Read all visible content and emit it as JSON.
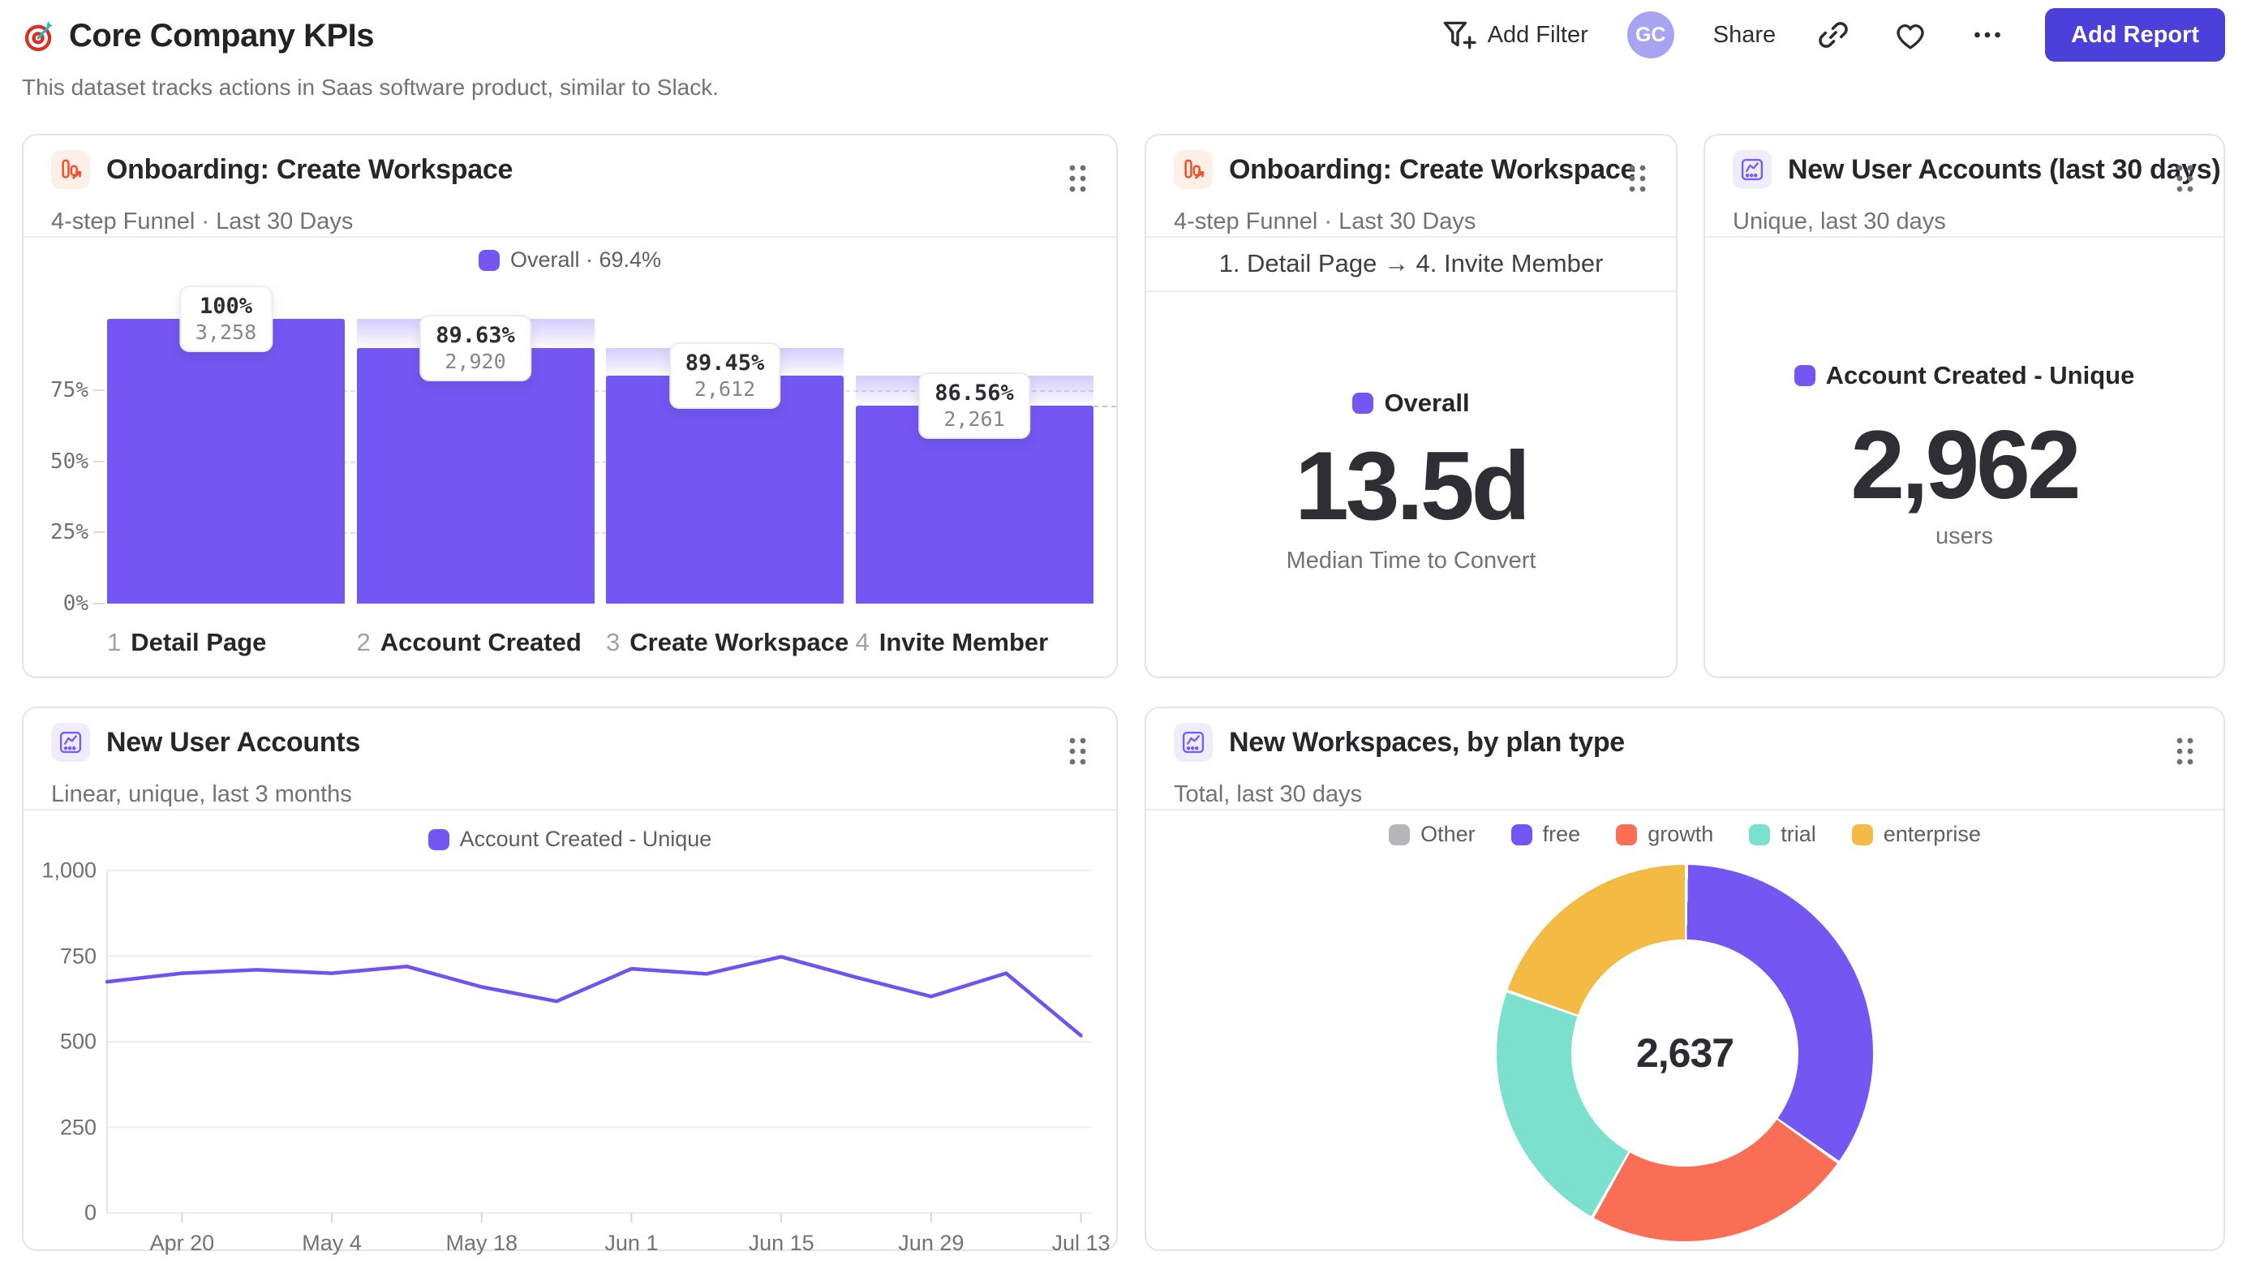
{
  "header": {
    "title": "Core Company KPIs",
    "subtitle": "This dataset tracks actions in Saas software product, similar to Slack.",
    "toolbar": {
      "add_filter_label": "Add Filter",
      "avatar_initials": "GC",
      "share_label": "Share",
      "add_report_label": "Add Report"
    }
  },
  "colors": {
    "accent_purple": "#7456f2",
    "coral": "#fb6e56",
    "teal": "#7ce0cf",
    "yellow": "#f3ba44",
    "gray_other": "#b6b6ba",
    "button_indigo": "#4b40d9",
    "avatar_bg": "#a9a4f2",
    "line_purple": "#6f52ef"
  },
  "cards": {
    "funnel_bars": {
      "title": "Onboarding: Create Workspace",
      "subtitle": "4-step Funnel · Last 30 Days",
      "legend": "Overall · 69.4%",
      "chart_data": {
        "type": "bar",
        "subtype": "funnel",
        "steps": [
          {
            "index": "1",
            "label": "Detail Page",
            "pct_label": "100%",
            "count_label": "3,258",
            "abs_height_pct": 100.0
          },
          {
            "index": "2",
            "label": "Account Created",
            "pct_label": "89.63%",
            "count_label": "2,920",
            "abs_height_pct": 89.63
          },
          {
            "index": "3",
            "label": "Create Workspace",
            "pct_label": "89.45%",
            "count_label": "2,612",
            "abs_height_pct": 80.17
          },
          {
            "index": "4",
            "label": "Invite Member",
            "pct_label": "86.56%",
            "count_label": "2,261",
            "abs_height_pct": 69.4
          }
        ],
        "y_ticks": [
          {
            "label": "0%",
            "value": 0
          },
          {
            "label": "25%",
            "value": 25
          },
          {
            "label": "50%",
            "value": 50
          },
          {
            "label": "75%",
            "value": 75
          }
        ],
        "overall_conversion_pct": 69.4,
        "ylim": [
          0,
          100
        ]
      }
    },
    "funnel_time": {
      "title": "Onboarding: Create Workspace",
      "subtitle": "4-step Funnel · Last 30 Days",
      "range_label": "1. Detail Page → 4. Invite Member",
      "legend": "Overall",
      "value": "13.5d",
      "caption": "Median Time to Convert"
    },
    "accounts_30d": {
      "title": "New User Accounts (last 30 days)",
      "subtitle": "Unique, last 30 days",
      "legend": "Account Created - Unique",
      "value": "2,962",
      "caption": "users"
    },
    "accounts_line": {
      "title": "New User Accounts",
      "subtitle": "Linear, unique, last 3 months",
      "legend": "Account Created - Unique",
      "chart_data": {
        "type": "line",
        "x_labels": [
          "Apr 20",
          "May 4",
          "May 18",
          "Jun 1",
          "Jun 15",
          "Jun 29",
          "Jul 13"
        ],
        "label_offset": 1,
        "label_every": 2,
        "values": [
          675,
          700,
          710,
          700,
          720,
          660,
          618,
          713,
          698,
          748,
          688,
          632,
          700,
          518
        ],
        "y_ticks": [
          {
            "label": "0",
            "value": 0
          },
          {
            "label": "250",
            "value": 250
          },
          {
            "label": "500",
            "value": 500
          },
          {
            "label": "750",
            "value": 750
          },
          {
            "label": "1,000",
            "value": 1000
          }
        ],
        "ylim": [
          0,
          1000
        ]
      }
    },
    "workspaces_donut": {
      "title": "New Workspaces, by plan type",
      "subtitle": "Total, last 30 days",
      "center_value": "2,637",
      "chart_data": {
        "type": "pie",
        "subtype": "donut",
        "total": 2637,
        "segments": [
          {
            "label": "Other",
            "value": 0,
            "color": "#b6b6ba"
          },
          {
            "label": "free",
            "value": 915,
            "color": "#7456f2"
          },
          {
            "label": "growth",
            "value": 615,
            "color": "#fb6e56"
          },
          {
            "label": "trial",
            "value": 585,
            "color": "#7ce0cf"
          },
          {
            "label": "enterprise",
            "value": 522,
            "color": "#f3ba44"
          }
        ]
      }
    }
  }
}
